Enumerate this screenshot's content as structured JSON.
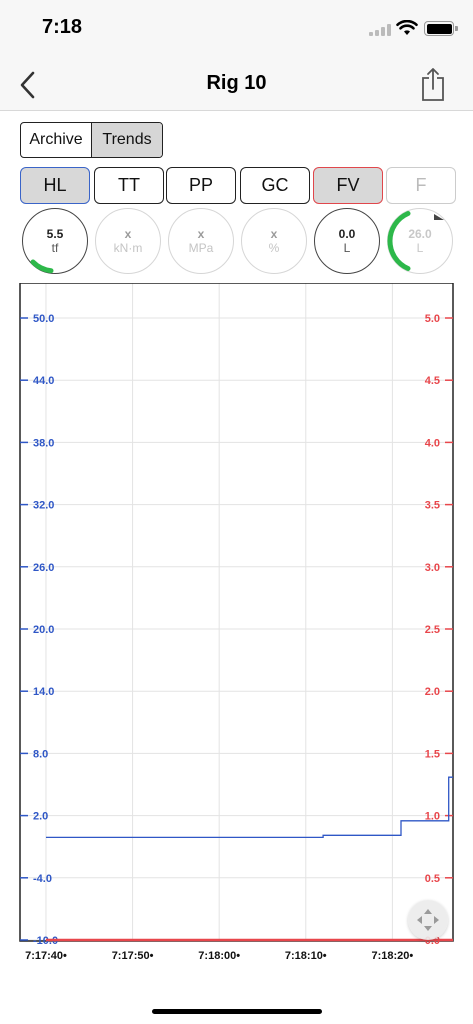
{
  "status": {
    "time": "7:18"
  },
  "nav": {
    "title": "Rig 10"
  },
  "segment": {
    "items": [
      "Archive",
      "Trends"
    ],
    "active": "Trends"
  },
  "tags": [
    {
      "label": "HL",
      "style": "hl"
    },
    {
      "label": "TT",
      "style": ""
    },
    {
      "label": "PP",
      "style": ""
    },
    {
      "label": "GC",
      "style": ""
    },
    {
      "label": "FV",
      "style": "fv"
    },
    {
      "label": "F",
      "style": "dim"
    }
  ],
  "gauges": [
    {
      "value": "5.5",
      "unit": "tf",
      "state": "on",
      "arc": "green-small"
    },
    {
      "value": "x",
      "unit": "kN·m",
      "state": "off"
    },
    {
      "value": "x",
      "unit": "MPa",
      "state": "off"
    },
    {
      "value": "x",
      "unit": "%",
      "state": "off"
    },
    {
      "value": "0.0",
      "unit": "L",
      "state": "on"
    },
    {
      "value": "26.0",
      "unit": "L",
      "state": "faded",
      "arc": "green-large"
    }
  ],
  "colors": {
    "left_axis": "#2f57c6",
    "right_axis": "#e8464b",
    "green": "#2db84a",
    "grid": "#e3e3e3"
  },
  "chart_data": {
    "type": "line",
    "x_ticks": [
      "7:17:40•",
      "7:17:50•",
      "7:18:00•",
      "7:18:10•",
      "7:18:20•"
    ],
    "left_axis": {
      "ticks": [
        "50.0",
        "44.0",
        "38.0",
        "32.0",
        "26.0",
        "20.0",
        "14.0",
        "8.0",
        "2.0",
        "-4.0",
        "-10.0"
      ],
      "ylim": [
        -10,
        50
      ]
    },
    "right_axis": {
      "ticks": [
        "5.0",
        "4.5",
        "4.0",
        "3.5",
        "3.0",
        "2.5",
        "2.0",
        "1.5",
        "1.0",
        "0.5",
        "0.0"
      ],
      "ylim": [
        0,
        5
      ]
    },
    "xlim_seconds": [
      -3,
      47
    ],
    "series": [
      {
        "axis": "left",
        "color": "#2f57c6",
        "points": [
          [
            0,
            -0.1
          ],
          [
            32,
            -0.1
          ],
          [
            32,
            0.1
          ],
          [
            41,
            0.1
          ],
          [
            41,
            1.5
          ],
          [
            46.5,
            1.5
          ],
          [
            46.5,
            5.7
          ],
          [
            47,
            5.7
          ]
        ]
      },
      {
        "axis": "right",
        "color": "#e8464b",
        "points": [
          [
            0,
            0.0
          ],
          [
            47,
            0.0
          ]
        ]
      }
    ]
  }
}
